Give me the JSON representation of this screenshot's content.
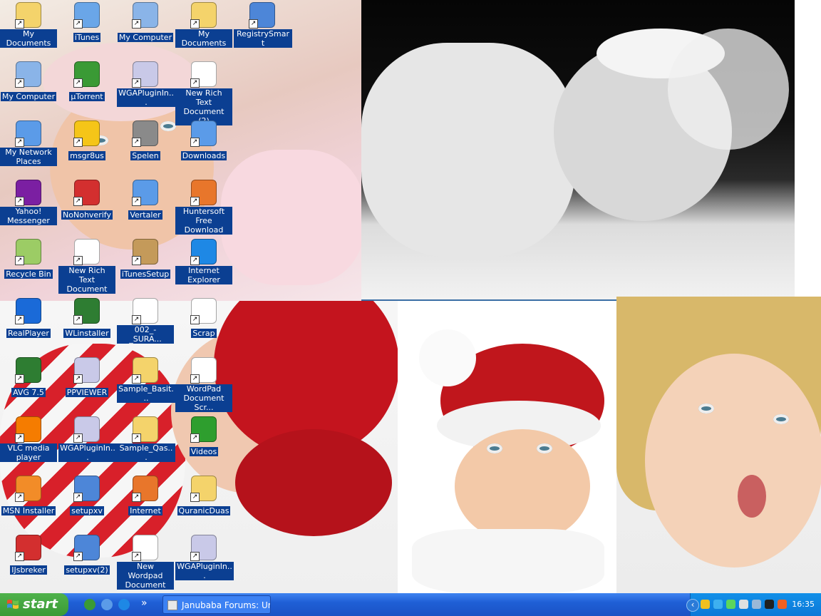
{
  "desktop": {
    "icons": [
      {
        "label": "My Documents",
        "icon": "folder-documents-icon",
        "color": "#f4d36b"
      },
      {
        "label": "iTunes",
        "icon": "itunes-icon",
        "color": "#6aa6e8"
      },
      {
        "label": "My Computer",
        "icon": "computer-icon",
        "color": "#8ab4e8"
      },
      {
        "label": "My Documents",
        "icon": "folder-documents-icon",
        "color": "#f4d36b"
      },
      {
        "label": "RegistrySmart",
        "icon": "key-icon",
        "color": "#4d86d8"
      },
      {
        "label": "My Computer",
        "icon": "computer-icon",
        "color": "#8ab4e8"
      },
      {
        "label": "µTorrent",
        "icon": "utorrent-icon",
        "color": "#3a9a35"
      },
      {
        "label": "WGAPluginIn...",
        "icon": "installer-icon",
        "color": "#c9c9e8"
      },
      {
        "label": "New Rich Text Document (2)",
        "icon": "rich-text-document-icon",
        "color": "#ffffff"
      },
      {
        "label": "My Network Places",
        "icon": "network-icon",
        "color": "#5b9be8"
      },
      {
        "label": "msgr8us",
        "icon": "messenger-smiley-icon",
        "color": "#f5c518"
      },
      {
        "label": "Spelen",
        "icon": "game-icon",
        "color": "#8a8a8a"
      },
      {
        "label": "Downloads",
        "icon": "window-shortcut-icon",
        "color": "#5b9be8"
      },
      {
        "label": "Yahoo! Messenger",
        "icon": "yahoo-messenger-icon",
        "color": "#7b1fa2"
      },
      {
        "label": "NoNohverify",
        "icon": "nonohverify-icon",
        "color": "#d32f2f"
      },
      {
        "label": "Vertaler",
        "icon": "window-shortcut-icon",
        "color": "#5b9be8"
      },
      {
        "label": "Huntersoft Free Download",
        "icon": "firefox-document-icon",
        "color": "#e8762b"
      },
      {
        "label": "Recycle Bin",
        "icon": "recycle-bin-icon",
        "color": "#9ccc65"
      },
      {
        "label": "New Rich Text Document",
        "icon": "rich-text-document-icon",
        "color": "#ffffff"
      },
      {
        "label": "iTunesSetup",
        "icon": "itunes-setup-icon",
        "color": "#c49a5a"
      },
      {
        "label": "Internet Explorer",
        "icon": "internet-explorer-icon",
        "color": "#1e88e5"
      },
      {
        "label": "RealPlayer",
        "icon": "realplayer-icon",
        "color": "#1a6ad8"
      },
      {
        "label": "WLinstaller",
        "icon": "windows-logo-icon",
        "color": "#2e7d32"
      },
      {
        "label": "002_-_SURA...",
        "icon": "mp3-file-icon",
        "color": "#ffffff"
      },
      {
        "label": "Scrap",
        "icon": "scrap-document-icon",
        "color": "#ffffff"
      },
      {
        "label": "AVG 7.5",
        "icon": "avg-icon",
        "color": "#2e7d32"
      },
      {
        "label": "PPVIEWER",
        "icon": "installer-icon",
        "color": "#c9c9e8"
      },
      {
        "label": "Sample_Basit...",
        "icon": "zip-folder-icon",
        "color": "#f4d36b"
      },
      {
        "label": "WordPad Document Scr...",
        "icon": "wordpad-document-icon",
        "color": "#ffffff"
      },
      {
        "label": "VLC media player",
        "icon": "vlc-icon",
        "color": "#f57c00"
      },
      {
        "label": "WGAPluginIn...",
        "icon": "installer-icon",
        "color": "#c9c9e8"
      },
      {
        "label": "Sample_Qas...",
        "icon": "zip-folder-icon",
        "color": "#f4d36b"
      },
      {
        "label": "Videos",
        "icon": "play-arrow-icon",
        "color": "#2e9e2e"
      },
      {
        "label": "MSN Installer",
        "icon": "msn-butterfly-icon",
        "color": "#f28c28"
      },
      {
        "label": "setupxv",
        "icon": "key-icon",
        "color": "#4d86d8"
      },
      {
        "label": "Internet",
        "icon": "firefox-icon",
        "color": "#e8762b"
      },
      {
        "label": "QuranicDuas",
        "icon": "zip-folder-icon",
        "color": "#f4d36b"
      },
      {
        "label": "IJsbreker",
        "icon": "ijsbreker-icon",
        "color": "#d32f2f"
      },
      {
        "label": "setupxv(2)",
        "icon": "key-icon",
        "color": "#4d86d8"
      },
      {
        "label": "New Wordpad Document",
        "icon": "wordpad-document-icon",
        "color": "#ffffff"
      },
      {
        "label": "WGAPluginIn...",
        "icon": "installer-icon",
        "color": "#c9c9e8"
      }
    ]
  },
  "taskbar": {
    "start_label": "start",
    "quick_launch": [
      {
        "icon": "utorrent-quicklaunch-icon",
        "color": "#3a9a35"
      },
      {
        "icon": "network-quicklaunch-icon",
        "color": "#5b9be8"
      },
      {
        "icon": "internet-explorer-quicklaunch-icon",
        "color": "#1e88e5"
      }
    ],
    "overflow_label": "»",
    "task_label": "Janubaba Forums: Ur...",
    "tray": {
      "expand_label": "‹",
      "icons": [
        {
          "icon": "security-shield-icon",
          "color": "#f0c020"
        },
        {
          "icon": "star-tray-icon",
          "color": "#3db0f0"
        },
        {
          "icon": "messenger-tray-icon",
          "color": "#5cd65c"
        },
        {
          "icon": "msn-tray-icon",
          "color": "#e0e0e0"
        },
        {
          "icon": "network-tray-icon",
          "color": "#9ab8d8"
        },
        {
          "icon": "avg-tray-icon",
          "color": "#202020"
        },
        {
          "icon": "flame-tray-icon",
          "color": "#f06020"
        }
      ],
      "clock": "16:35"
    }
  }
}
